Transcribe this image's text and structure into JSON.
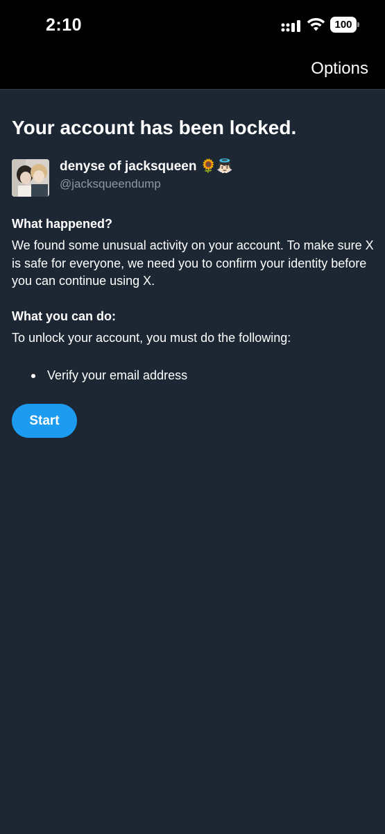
{
  "status_bar": {
    "time": "2:10",
    "battery_level": "100",
    "icons": [
      "cellular-signal-icon",
      "wifi-icon",
      "battery-icon"
    ]
  },
  "nav": {
    "options_label": "Options"
  },
  "main": {
    "title": "Your account has been locked.",
    "account": {
      "display_name": "denyse of jacksqueen 🌻👼🏻",
      "handle": "@jacksqueendump"
    },
    "what_happened": {
      "heading": "What happened?",
      "body": "We found some unusual activity on your account. To make sure X is safe for everyone, we need you to confirm your identity before you can continue using X."
    },
    "what_you_can_do": {
      "heading": "What you can do:",
      "body": "To unlock your account, you must do the following:",
      "items": [
        "Verify your email address"
      ]
    },
    "start_label": "Start"
  },
  "colors": {
    "background": "#1c2733",
    "bar_background": "#000000",
    "accent": "#1d9bf0",
    "secondary_text": "#8b98a5"
  }
}
